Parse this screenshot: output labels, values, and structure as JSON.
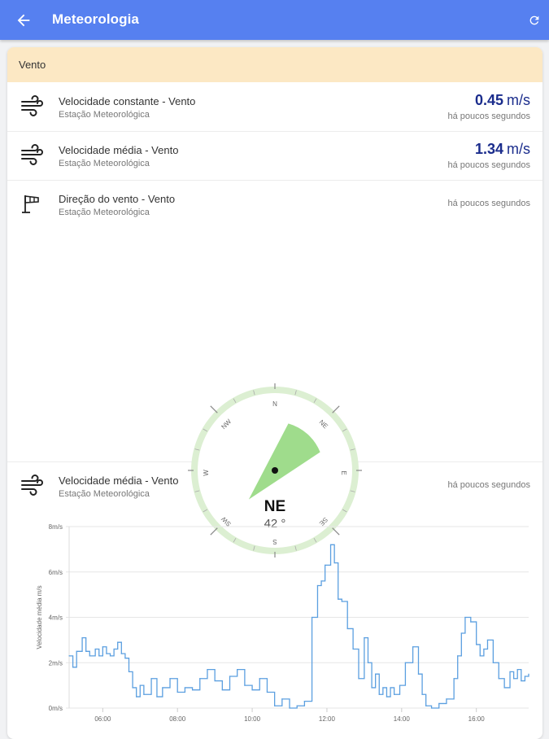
{
  "appbar": {
    "title": "Meteorologia",
    "back_icon": "arrow-left-icon",
    "refresh_icon": "refresh-icon",
    "color": "#5680f0"
  },
  "section": {
    "title": "Vento"
  },
  "sensors": [
    {
      "name": "Velocidade constante - Vento",
      "source": "Estação Meteorológica",
      "value": "0.45",
      "unit": "m/s",
      "time": "há poucos segundos",
      "icon": "wind-icon"
    },
    {
      "name": "Velocidade média - Vento",
      "source": "Estação Meteorológica",
      "value": "1.34",
      "unit": "m/s",
      "time": "há poucos segundos",
      "icon": "wind-icon"
    },
    {
      "name": "Direção do vento - Vento",
      "source": "Estação Meteorológica",
      "time": "há poucos segundos",
      "icon": "windsock-icon"
    }
  ],
  "compass": {
    "direction": "NE",
    "degrees": "42 °",
    "heading_deg": 42,
    "labels": [
      "N",
      "NE",
      "E",
      "SE",
      "S",
      "SW",
      "W",
      "NW"
    ],
    "ring_color": "#dcefd2",
    "sector_color": "#9fdc8c"
  },
  "chart_section": {
    "name": "Velocidade média - Vento",
    "source": "Estação Meteorológica",
    "time": "há poucos segundos",
    "icon": "wind-icon"
  },
  "chart_data": {
    "type": "line",
    "ylabel": "Velocidade média m/s",
    "ylim": [
      0,
      8
    ],
    "y_ticks": [
      0,
      2,
      4,
      6,
      8
    ],
    "y_tick_labels": [
      "0m/s",
      "2m/s",
      "4m/s",
      "6m/s",
      "8m/s"
    ],
    "x_ticks": [
      "06:00",
      "08:00",
      "10:00",
      "12:00",
      "14:00",
      "16:00"
    ],
    "x_tick_hours": [
      6,
      8,
      10,
      12,
      14,
      16
    ],
    "xlim": [
      5.1,
      17.4
    ],
    "grid": true,
    "color": "#5b9fe0",
    "series": [
      {
        "x": [
          5.1,
          5.2,
          5.3,
          5.45,
          5.55,
          5.65,
          5.8,
          5.9,
          6.0,
          6.1,
          6.2,
          6.3,
          6.4,
          6.5,
          6.6,
          6.7,
          6.8,
          6.9,
          7.0,
          7.1,
          7.3,
          7.45,
          7.6,
          7.8,
          8.0,
          8.2,
          8.4,
          8.6,
          8.8,
          9.0,
          9.2,
          9.4,
          9.6,
          9.8,
          10.0,
          10.2,
          10.4,
          10.6,
          10.8,
          11.0,
          11.2,
          11.4,
          11.6,
          11.75,
          11.85,
          11.95,
          12.1,
          12.2,
          12.3,
          12.4,
          12.55,
          12.7,
          12.85,
          13.0,
          13.1,
          13.2,
          13.3,
          13.4,
          13.5,
          13.6,
          13.7,
          13.8,
          13.95,
          14.1,
          14.3,
          14.45,
          14.55,
          14.65,
          14.8,
          15.0,
          15.2,
          15.4,
          15.5,
          15.6,
          15.7,
          15.85,
          16.0,
          16.1,
          16.2,
          16.3,
          16.45,
          16.6,
          16.75,
          16.9,
          17.0,
          17.1,
          17.2,
          17.3,
          17.4
        ],
        "values": [
          2.3,
          1.8,
          2.5,
          3.1,
          2.5,
          2.3,
          2.6,
          2.3,
          2.7,
          2.4,
          2.3,
          2.6,
          2.9,
          2.4,
          2.2,
          1.6,
          0.9,
          0.5,
          1.0,
          0.6,
          1.3,
          0.5,
          0.9,
          1.3,
          0.7,
          0.9,
          0.8,
          1.3,
          1.7,
          1.2,
          0.8,
          1.4,
          1.7,
          1.0,
          0.8,
          1.3,
          0.7,
          0.1,
          0.4,
          0.0,
          0.1,
          0.3,
          4.0,
          5.4,
          5.6,
          6.3,
          7.2,
          6.4,
          4.8,
          4.7,
          3.5,
          2.6,
          1.3,
          3.1,
          2.0,
          0.9,
          1.5,
          0.6,
          0.9,
          0.5,
          0.9,
          0.6,
          1.0,
          2.0,
          2.7,
          1.5,
          0.6,
          0.1,
          0.0,
          0.2,
          0.4,
          1.3,
          2.3,
          3.3,
          4.0,
          3.8,
          2.8,
          2.3,
          2.6,
          3.0,
          2.0,
          1.3,
          0.9,
          1.6,
          1.3,
          1.7,
          1.2,
          1.4,
          1.5
        ]
      }
    ]
  }
}
